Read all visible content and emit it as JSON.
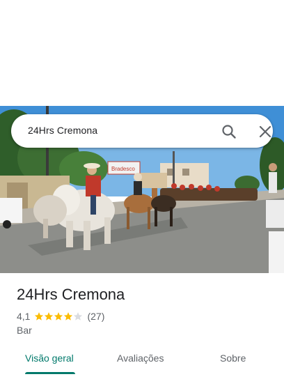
{
  "search": {
    "query": "24Hrs Cremona",
    "search_icon": "search-icon",
    "close_icon": "close-icon"
  },
  "place": {
    "name": "24Hrs Cremona",
    "rating": "4,1",
    "rating_fraction": 0.82,
    "stars_filled": 4,
    "stars_total": 5,
    "review_count": "(27)",
    "category": "Bar"
  },
  "tabs": [
    {
      "label": "Visão geral",
      "active": true
    },
    {
      "label": "Avaliações",
      "active": false
    },
    {
      "label": "Sobre",
      "active": false
    }
  ],
  "colors": {
    "accent": "#00796b",
    "star": "#fbbc04",
    "star_empty": "#dadce0",
    "text_primary": "#202124",
    "text_secondary": "#5f6368"
  },
  "hero_photo": {
    "signboard_text": "Bradesco"
  }
}
